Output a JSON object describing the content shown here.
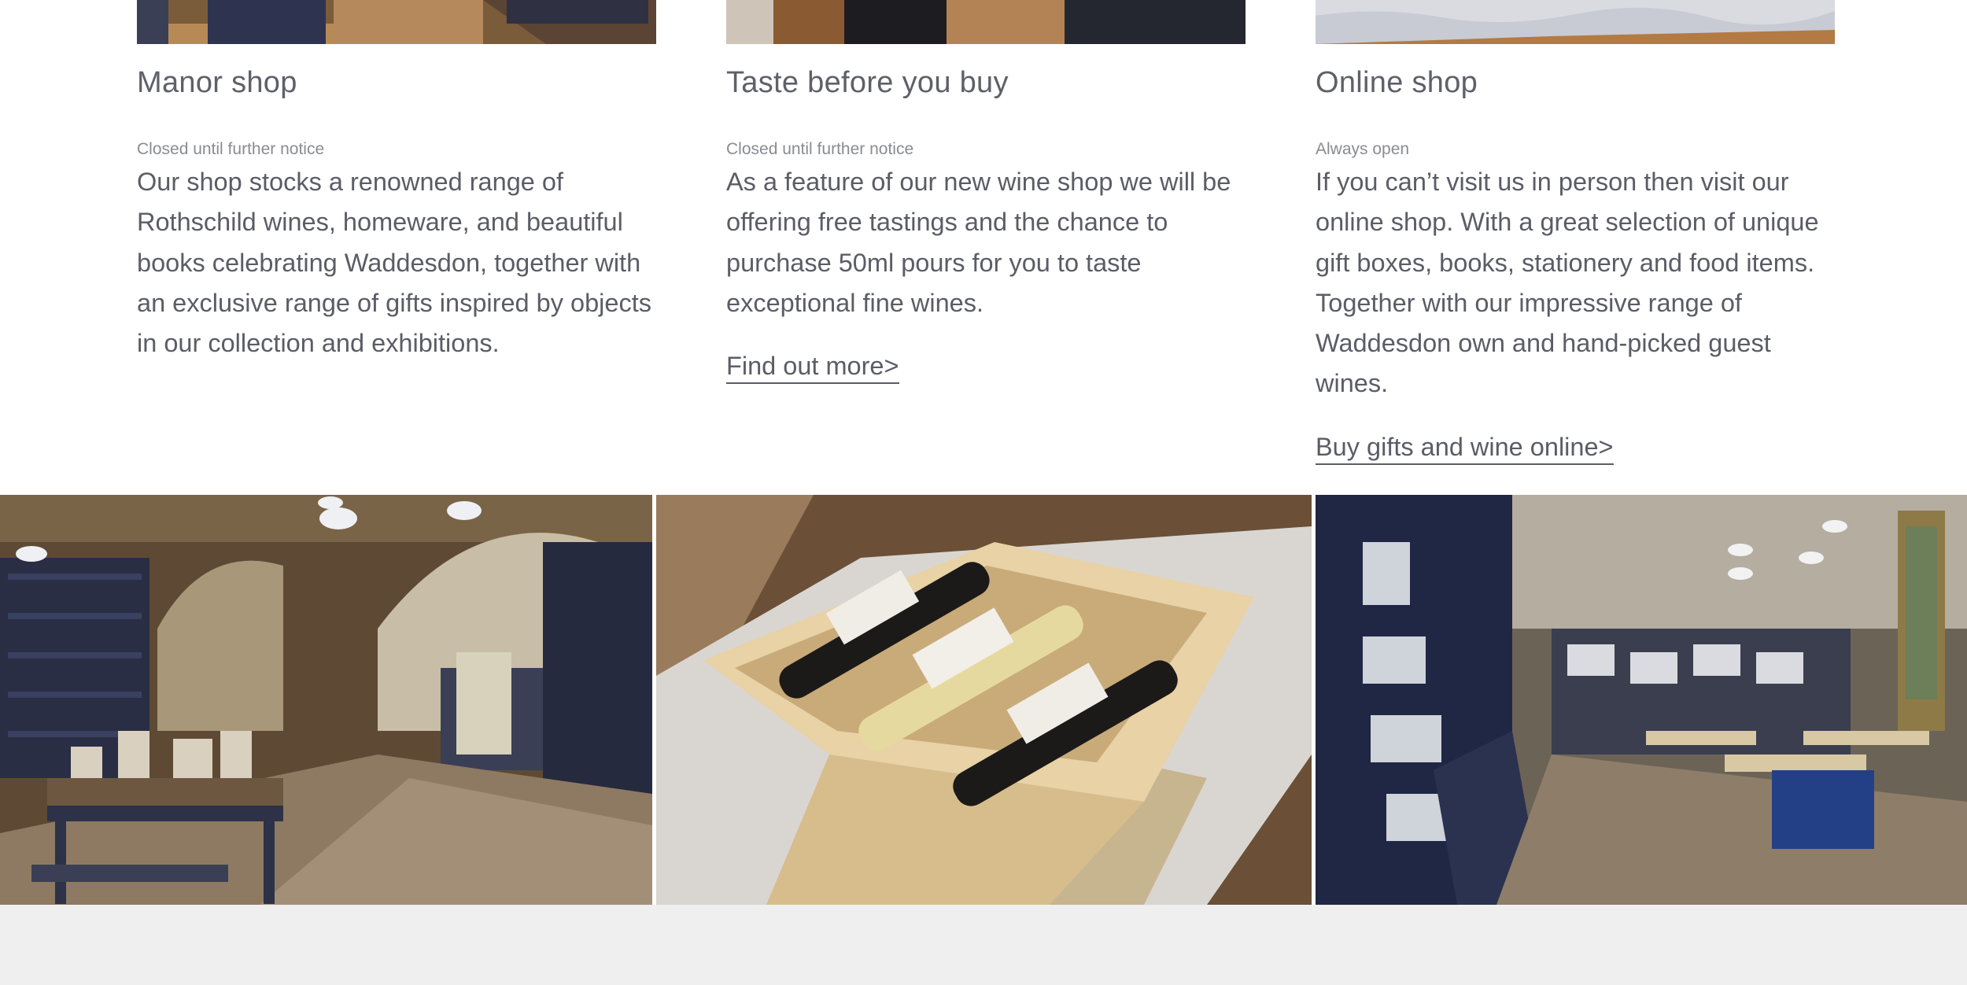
{
  "columns": [
    {
      "title": "Manor shop",
      "status": "Closed until further notice",
      "body": "Our shop stocks a renowned range of Rothschild wines, homeware, and beautiful books celebrating Waddesdon, together with an exclusive range of gifts inspired by objects in our collection and exhibitions."
    },
    {
      "title": "Taste before you buy",
      "status": "Closed until further notice",
      "body": "As a feature of our new wine shop we will be offering free tastings and the chance to purchase 50ml pours for you to taste exceptional fine wines.",
      "link": "Find out more>"
    },
    {
      "title": "Online shop",
      "status": "Always open",
      "body": "If you can’t visit us in person then visit our online shop. With a great selection of unique gift boxes, books, stationery and food items. Together with our impressive range of Waddesdon own and hand-picked guest wines.",
      "link": "Buy gifts and wine online>"
    }
  ],
  "colors": {
    "text": "#5b5c66",
    "muted": "#8a8b93",
    "footer": "#efefef"
  }
}
